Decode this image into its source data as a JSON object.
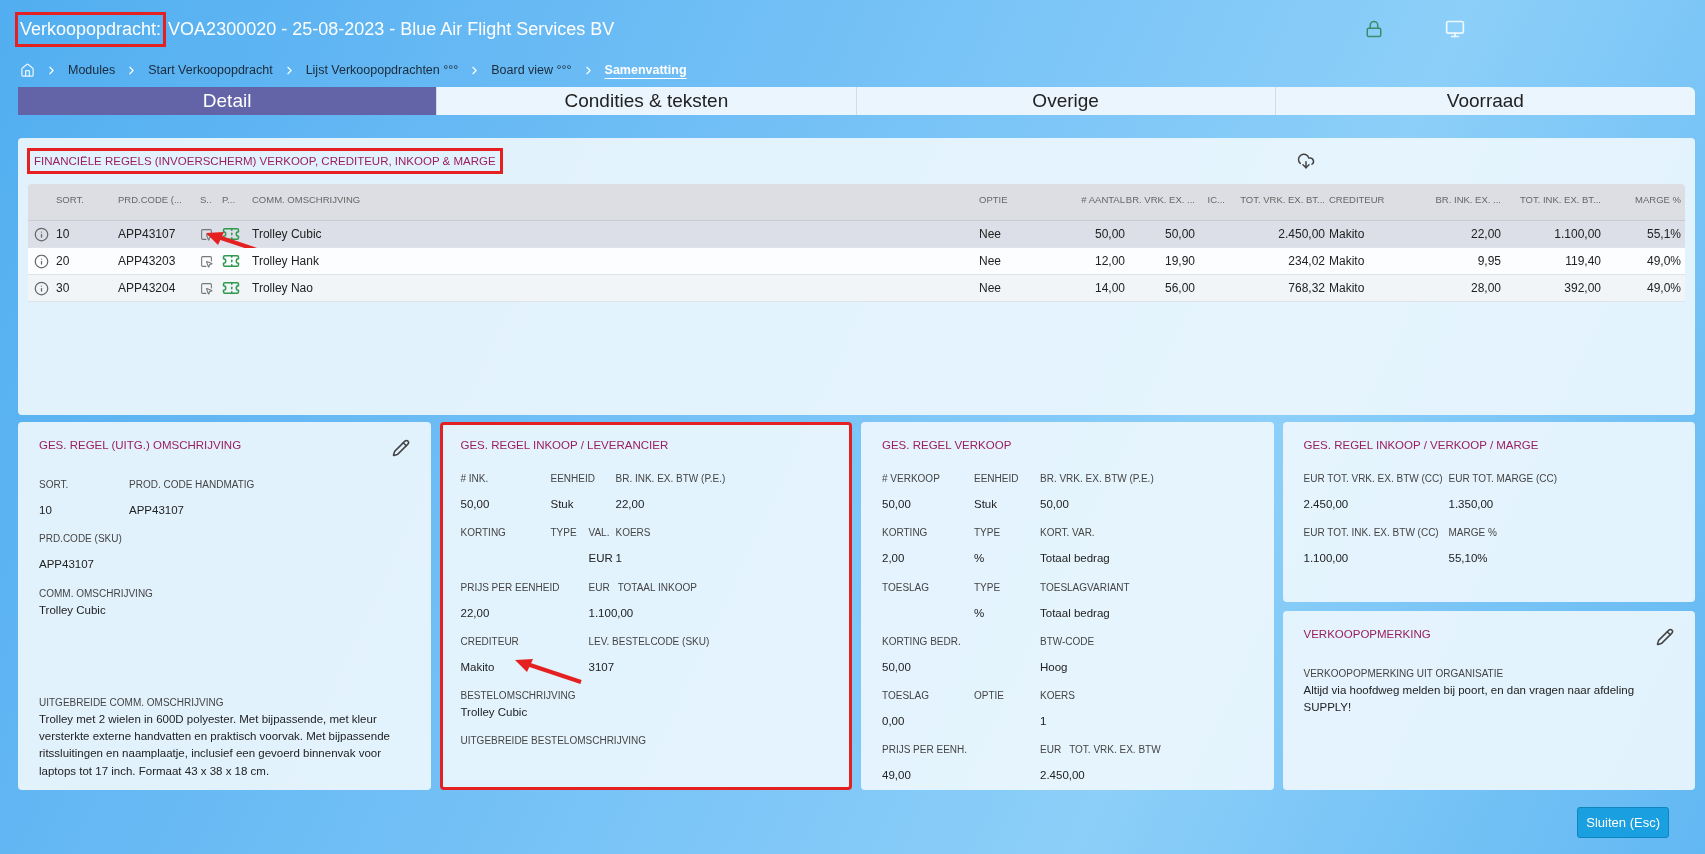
{
  "window": {
    "title_label": "Verkoopopdracht:",
    "title": "VOA2300020 - 25-08-2023 - Blue Air Flight Services BV",
    "title_highlighted": true
  },
  "breadcrumbs": [
    {
      "label": "Modules",
      "selected": false
    },
    {
      "label": "Start Verkoopopdracht",
      "selected": false
    },
    {
      "label": "Lijst Verkoopopdrachten °°°",
      "selected": false
    },
    {
      "label": "Board view °°°",
      "selected": false
    },
    {
      "label": "Samenvatting",
      "selected": true
    }
  ],
  "tabs": [
    {
      "label": "Detail",
      "selected": true
    },
    {
      "label": "Condities & teksten",
      "selected": false
    },
    {
      "label": "Overige",
      "selected": false
    },
    {
      "label": "Voorraad",
      "selected": false
    }
  ],
  "table": {
    "title": "FINANCIËLE REGELS (INVOERSCHERM) VERKOOP, CREDITEUR, INKOOP & MARGE",
    "title_highlighted": true,
    "columns": [
      {
        "kind": "info-icon"
      },
      {
        "label": "SORT.",
        "kind": "text"
      },
      {
        "label": "PRD.CODE (...",
        "kind": "text"
      },
      {
        "label": "S..",
        "kind": "select-icon"
      },
      {
        "label": "P...",
        "kind": "tag-icon"
      },
      {
        "label": "COMM. OMSCHRIJVING",
        "kind": "text"
      },
      {
        "label": "OPTIE",
        "kind": "text"
      },
      {
        "label": "# AANTAL",
        "kind": "number"
      },
      {
        "label": "BR. VRK. EX. ...",
        "kind": "number"
      },
      {
        "label": "IC...",
        "kind": "number"
      },
      {
        "label": "TOT. VRK. EX. BT...",
        "kind": "number"
      },
      {
        "label": "CREDITEUR",
        "kind": "text"
      },
      {
        "label": "BR. INK. EX. ...",
        "kind": "number"
      },
      {
        "label": "TOT. INK. EX. BT...",
        "kind": "number"
      },
      {
        "label": "MARGE %",
        "kind": "number"
      }
    ],
    "rows": [
      {
        "selected": true,
        "arrow": true,
        "cells": [
          null,
          "10",
          "APP43107",
          null,
          null,
          "Trolley Cubic",
          "Nee",
          "50,00",
          "50,00",
          null,
          "2.450,00",
          "Makito",
          "22,00",
          "1.100,00",
          "55,1%"
        ]
      },
      {
        "selected": false,
        "arrow": false,
        "cells": [
          null,
          "20",
          "APP43203",
          null,
          null,
          "Trolley Hank",
          "Nee",
          "12,00",
          "19,90",
          null,
          "234,02",
          "Makito",
          "9,95",
          "119,40",
          "49,0%"
        ]
      },
      {
        "selected": false,
        "arrow": false,
        "cells": [
          null,
          "30",
          "APP43204",
          null,
          null,
          "Trolley Nao",
          "Nee",
          "14,00",
          "56,00",
          null,
          "768,32",
          "Makito",
          "28,00",
          "392,00",
          "49,0%"
        ]
      }
    ]
  },
  "panels": [
    {
      "title": "GES. REGEL (UITG.) OMSCHRIJVING",
      "editable": true,
      "highlighted": false,
      "rows": [
        {
          "kind": "grid",
          "fields": [
            {
              "label": "SORT.",
              "value": "10"
            },
            {
              "label": "PROD. CODE HANDMATIG",
              "value": "APP43107"
            }
          ]
        },
        {
          "kind": "grid",
          "fields": [
            {
              "label": "PRD.CODE (SKU)",
              "value": "APP43107"
            }
          ]
        },
        {
          "kind": "text",
          "fields": [
            {
              "label": "COMM. OMSCHRIJVING",
              "value": "Trolley Cubic"
            }
          ]
        },
        {
          "kind": "bottom-text",
          "fields": [
            {
              "label": "UITGEBREIDE COMM. OMSCHRIJVING",
              "value": "Trolley met 2 wielen in 600D polyester. Met bijpassende, met kleur versterkte externe handvatten en praktisch voorvak. Met bijpassende ritssluitingen en naamplaatje, inclusief een gevoerd binnenvak voor laptops tot 17 inch. Formaat 43 x 38 x 18 cm."
            }
          ]
        }
      ]
    },
    {
      "title": "GES. REGEL INKOOP / LEVERANCIER",
      "editable": false,
      "highlighted": true,
      "rows": [
        {
          "kind": "grid",
          "fields": [
            {
              "label": "# INK.",
              "value": "50,00"
            },
            {
              "label": "EENHEID",
              "value": "Stuk"
            },
            {
              "label": "BR. INK. EX. BTW (P.E.)",
              "value": "22,00"
            }
          ]
        },
        {
          "kind": "grid",
          "fields": [
            {
              "label": "KORTING"
            },
            {
              "label": "TYPE"
            },
            {
              "label": "VAL.",
              "value": "EUR"
            },
            {
              "label": "KOERS",
              "value": "1"
            }
          ]
        },
        {
          "kind": "grid",
          "fields": [
            {
              "label": "PRIJS PER EENHEID",
              "value": "22,00"
            },
            {
              "prefix": "EUR",
              "label": "TOTAAL INKOOP",
              "value": "1.100,00"
            }
          ]
        },
        {
          "kind": "grid",
          "fields": [
            {
              "label": "CREDITEUR",
              "value": "Makito",
              "arrow": true
            },
            {
              "label": "LEV. BESTELCODE (SKU)",
              "value": "3107"
            }
          ]
        },
        {
          "kind": "text",
          "fields": [
            {
              "label": "BESTELOMSCHRIJVING",
              "value": "Trolley Cubic"
            }
          ]
        },
        {
          "kind": "text",
          "fields": [
            {
              "label": "UITGEBREIDE BESTELOMSCHRIJVING"
            }
          ]
        }
      ]
    },
    {
      "title": "GES. REGEL VERKOOP",
      "editable": false,
      "highlighted": false,
      "rows": [
        {
          "kind": "grid",
          "fields": [
            {
              "label": "# VERKOOP",
              "value": "50,00"
            },
            {
              "label": "EENHEID",
              "value": "Stuk"
            },
            {
              "label": "BR. VRK. EX. BTW (P.E.)",
              "value": "50,00"
            }
          ]
        },
        {
          "kind": "grid",
          "fields": [
            {
              "label": "KORTING",
              "value": "2,00"
            },
            {
              "label": "TYPE",
              "value": "%"
            },
            {
              "label": "KORT. VAR.",
              "value": "Totaal bedrag"
            }
          ]
        },
        {
          "kind": "grid",
          "fields": [
            {
              "label": "TOESLAG"
            },
            {
              "label": "TYPE",
              "value": "%"
            },
            {
              "label": "TOESLAGVARIANT",
              "value": "Totaal bedrag"
            }
          ]
        },
        {
          "kind": "grid-wide",
          "fields": [
            {
              "label": "KORTING BEDR.",
              "value": "50,00"
            },
            {
              "label": "BTW-CODE",
              "value": "Hoog"
            }
          ]
        },
        {
          "kind": "grid",
          "fields": [
            {
              "label": "TOESLAG",
              "value": "0,00"
            },
            {
              "label": "OPTIE"
            },
            {
              "label": "KOERS",
              "value": "1"
            }
          ]
        },
        {
          "kind": "grid-wide",
          "fields": [
            {
              "label": "PRIJS PER EENH.",
              "value": "49,00"
            },
            {
              "prefix": "EUR",
              "label": "TOT. VRK. EX. BTW",
              "value": "2.450,00"
            }
          ]
        }
      ]
    },
    {
      "title": "GES. REGEL INKOOP / VERKOOP / MARGE",
      "editable": false,
      "highlighted": false,
      "rows": [
        {
          "kind": "grid",
          "fields": [
            {
              "label": "EUR TOT. VRK. EX. BTW (CC)",
              "value": "2.450,00"
            },
            {
              "label": "EUR TOT. MARGE (CC)",
              "value": "1.350,00"
            }
          ]
        },
        {
          "kind": "grid",
          "fields": [
            {
              "label": "EUR TOT. INK. EX. BTW (CC)",
              "value": "1.100,00"
            },
            {
              "label": "MARGE %",
              "value": "55,10%"
            }
          ]
        }
      ]
    },
    {
      "title": "VERKOOPOPMERKING",
      "editable": true,
      "highlighted": false,
      "rows": [
        {
          "kind": "text",
          "fields": [
            {
              "label": "VERKOOPOPMERKING UIT ORGANISATIE",
              "value": "Altijd via hoofdweg melden bij poort, en dan vragen naar afdeling SUPPLY!"
            }
          ]
        }
      ]
    }
  ],
  "footer": {
    "close_button": "Sluiten (Esc)"
  }
}
